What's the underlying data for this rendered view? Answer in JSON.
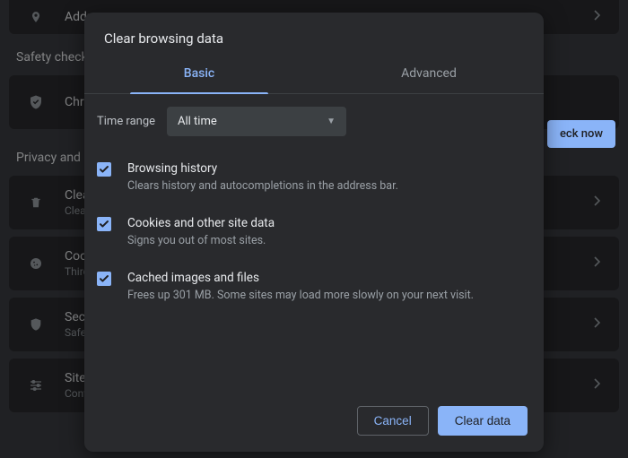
{
  "bg": {
    "addresses": "Addresses",
    "safety_check": "Safety check",
    "chrome": "Chrome",
    "check_now": "eck now",
    "privacy": "Privacy and security",
    "rows": [
      {
        "title": "Clear browsing data",
        "sub": "Clear history, cookies, cache, and more"
      },
      {
        "title": "Cookies and other site data",
        "sub": "Third-party cookies are blocked in Incognito mode"
      },
      {
        "title": "Security",
        "sub": "Safe Browsing (protection from dangerous sites) and other security settings"
      },
      {
        "title": "Site settings",
        "sub": "Controls what information sites can use and show"
      }
    ]
  },
  "modal": {
    "title": "Clear browsing data",
    "tabs": {
      "basic": "Basic",
      "advanced": "Advanced"
    },
    "time_range_label": "Time range",
    "time_range_value": "All time",
    "options": [
      {
        "title": "Browsing history",
        "desc": "Clears history and autocompletions in the address bar.",
        "checked": true
      },
      {
        "title": "Cookies and other site data",
        "desc": "Signs you out of most sites.",
        "checked": true
      },
      {
        "title": "Cached images and files",
        "desc": "Frees up 301 MB. Some sites may load more slowly on your next visit.",
        "checked": true
      }
    ],
    "cancel": "Cancel",
    "clear": "Clear data"
  }
}
